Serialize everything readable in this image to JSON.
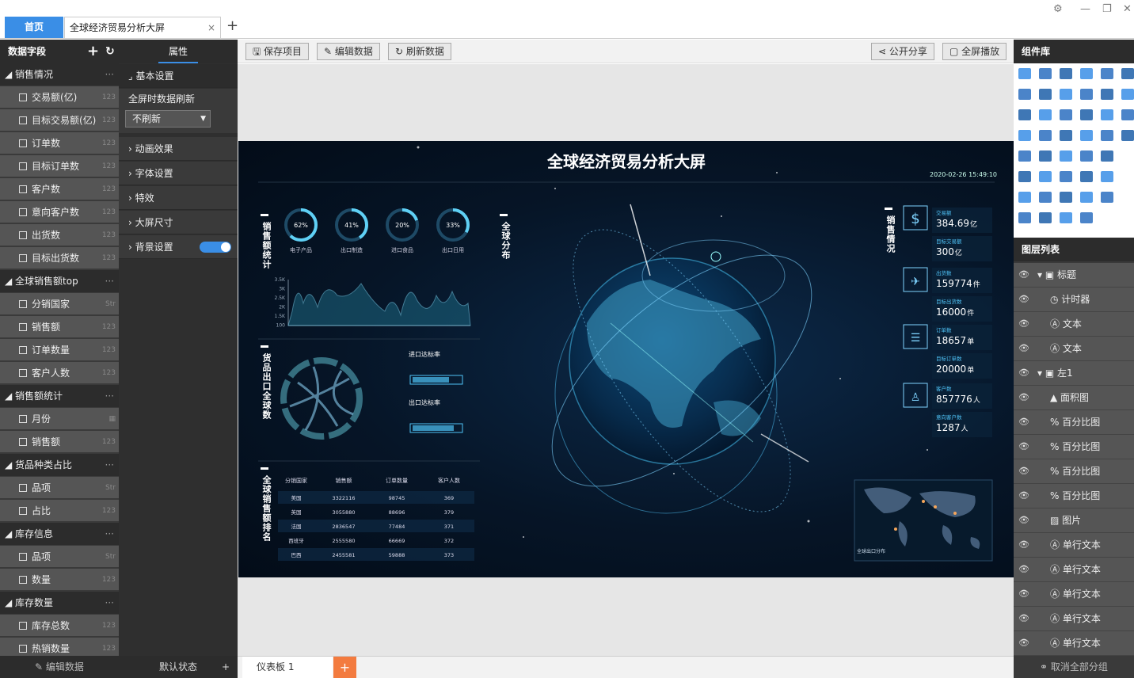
{
  "tabs": {
    "home": "首页",
    "doc": "全球经济贸易分析大屏",
    "close": "×",
    "add": "+"
  },
  "window": {
    "settings": "⚙",
    "minimize": "—",
    "restore": "❐",
    "close": "✕"
  },
  "left": {
    "title": "数据字段",
    "add": "+",
    "refresh": "↻",
    "foot": "编辑数据",
    "groups": [
      {
        "name": "销售情况",
        "fields": [
          [
            "交易额(亿)",
            "123"
          ],
          [
            "目标交易额(亿)",
            "123"
          ],
          [
            "订单数",
            "123"
          ],
          [
            "目标订单数",
            "123"
          ],
          [
            "客户数",
            "123"
          ],
          [
            "意向客户数",
            "123"
          ],
          [
            "出货数",
            "123"
          ],
          [
            "目标出货数",
            "123"
          ]
        ]
      },
      {
        "name": "全球销售额top",
        "fields": [
          [
            "分销国家",
            "Str"
          ],
          [
            "销售额",
            "123"
          ],
          [
            "订单数量",
            "123"
          ],
          [
            "客户人数",
            "123"
          ]
        ]
      },
      {
        "name": "销售额统计",
        "fields": [
          [
            "月份",
            "▦"
          ],
          [
            "销售额",
            "123"
          ]
        ]
      },
      {
        "name": "货品种类占比",
        "fields": [
          [
            "品项",
            "Str"
          ],
          [
            "占比",
            "123"
          ]
        ]
      },
      {
        "name": "库存信息",
        "fields": [
          [
            "品项",
            "Str"
          ],
          [
            "数量",
            "123"
          ]
        ]
      },
      {
        "name": "库存数量",
        "fields": [
          [
            "库存总数",
            "123"
          ],
          [
            "热销数量",
            "123"
          ]
        ]
      }
    ]
  },
  "props": {
    "tab": "属性",
    "basic": "基本设置",
    "refresh_label": "全屏时数据刷新",
    "refresh_value": "不刷新",
    "sections": [
      "动画效果",
      "字体设置",
      "特效",
      "大屏尺寸",
      "背景设置"
    ],
    "foot": "默认状态",
    "foot_add": "+"
  },
  "toolbar": {
    "save": "保存项目",
    "edit": "编辑数据",
    "refresh": "刷新数据",
    "share": "公开分享",
    "fullscreen": "全屏播放"
  },
  "bottom": {
    "sheet": "仪表板 1",
    "add": "+"
  },
  "right": {
    "components": "组件库",
    "layers": "图层列表",
    "foot": "取消全部分组",
    "layer_items": [
      {
        "name": "标题",
        "indent": 0,
        "group": true,
        "icon": "folder-icon"
      },
      {
        "name": "计时器",
        "indent": 1,
        "icon": "clock-icon"
      },
      {
        "name": "文本",
        "indent": 1,
        "icon": "text-icon"
      },
      {
        "name": "文本",
        "indent": 1,
        "icon": "text-icon"
      },
      {
        "name": "左1",
        "indent": 0,
        "group": true,
        "icon": "folder-icon"
      },
      {
        "name": "面积图",
        "indent": 1,
        "icon": "area-icon"
      },
      {
        "name": "百分比图",
        "indent": 1,
        "icon": "percent-icon"
      },
      {
        "name": "百分比图",
        "indent": 1,
        "icon": "percent-icon"
      },
      {
        "name": "百分比图",
        "indent": 1,
        "icon": "percent-icon"
      },
      {
        "name": "百分比图",
        "indent": 1,
        "icon": "percent-icon"
      },
      {
        "name": "图片",
        "indent": 1,
        "icon": "image-icon"
      },
      {
        "name": "单行文本",
        "indent": 1,
        "icon": "text-icon"
      },
      {
        "name": "单行文本",
        "indent": 1,
        "icon": "text-icon"
      },
      {
        "name": "单行文本",
        "indent": 1,
        "icon": "text-icon"
      },
      {
        "name": "单行文本",
        "indent": 1,
        "icon": "text-icon"
      },
      {
        "name": "单行文本",
        "indent": 1,
        "icon": "text-icon"
      }
    ]
  },
  "screen": {
    "title": "全球经济贸易分析大屏",
    "time": "2020-02-26 15:49:10",
    "sec_sales_stats": "销售额统计",
    "sec_global": "全球分布",
    "sec_export": "货品出口全球数",
    "sec_rank": "全球销售额排名",
    "sec_sales": "销售情况",
    "rings": [
      {
        "pct": 62,
        "label": "电子产品"
      },
      {
        "pct": 41,
        "label": "出口制造"
      },
      {
        "pct": 20,
        "label": "进口食品"
      },
      {
        "pct": 33,
        "label": "出口日用"
      }
    ],
    "area_chart": {
      "yticks": [
        "3.5K",
        "3K",
        "2.5K",
        "2K",
        "1.5K",
        "100"
      ]
    },
    "import_rate": "进口达标率",
    "export_rate": "出口达标率",
    "table": {
      "headers": [
        "分销国家",
        "销售额",
        "订单数量",
        "客户人数"
      ],
      "rows": [
        [
          "美国",
          "3322116",
          "98745",
          "369"
        ],
        [
          "英国",
          "3055880",
          "88696",
          "379"
        ],
        [
          "法国",
          "2836547",
          "77484",
          "371"
        ],
        [
          "西班牙",
          "2555580",
          "66669",
          "372"
        ],
        [
          "巴西",
          "2455581",
          "59888",
          "373"
        ]
      ]
    },
    "kpis": [
      {
        "label": "交易额",
        "value": "384.69",
        "unit": "亿"
      },
      {
        "label": "目标交易额",
        "value": "300",
        "unit": "亿"
      },
      {
        "label": "出货数",
        "value": "159774",
        "unit": "件"
      },
      {
        "label": "目标出货数",
        "value": "16000",
        "unit": "件"
      },
      {
        "label": "订单数",
        "value": "18657",
        "unit": "单"
      },
      {
        "label": "目标订单数",
        "value": "20000",
        "unit": "单"
      },
      {
        "label": "客户数",
        "value": "857776",
        "unit": "人"
      },
      {
        "label": "意向客户数",
        "value": "1287",
        "unit": "人"
      }
    ],
    "map_label": "全球出口分布"
  }
}
